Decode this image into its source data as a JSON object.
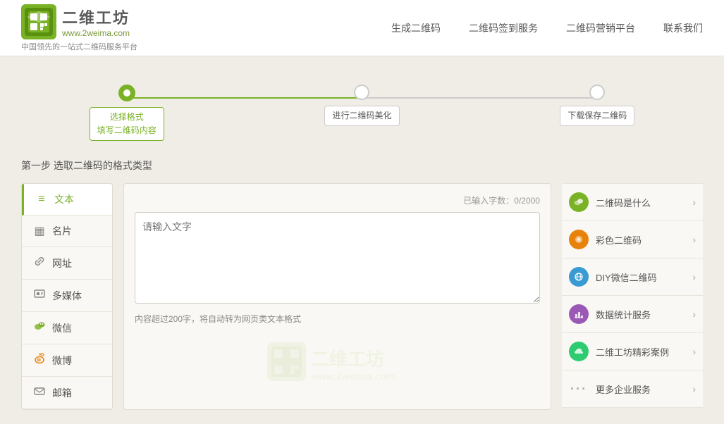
{
  "header": {
    "logo_title": "二维工坊",
    "logo_url": "www.2weima.com",
    "logo_subtitle": "中国领先的一站式二维码服务平台",
    "nav": [
      {
        "label": "生成二维码",
        "id": "nav-generate"
      },
      {
        "label": "二维码签到服务",
        "id": "nav-checkin"
      },
      {
        "label": "二维码营销平台",
        "id": "nav-marketing"
      },
      {
        "label": "联系我们",
        "id": "nav-contact"
      }
    ]
  },
  "steps": [
    {
      "label": "选择格式\n填写二维码内容",
      "active": true
    },
    {
      "label": "进行二维码美化",
      "active": false
    },
    {
      "label": "下载保存二维码",
      "active": false
    }
  ],
  "section_title": "第一步 选取二维码的格式类型",
  "sidebar": {
    "items": [
      {
        "id": "text",
        "label": "文本",
        "icon": "≡",
        "active": true
      },
      {
        "id": "card",
        "label": "名片",
        "icon": "▦"
      },
      {
        "id": "url",
        "label": "网址",
        "icon": "🔗"
      },
      {
        "id": "media",
        "label": "多媒体",
        "icon": "📋"
      },
      {
        "id": "wechat",
        "label": "微信",
        "icon": "💬"
      },
      {
        "id": "weibo",
        "label": "微博",
        "icon": "🐦"
      },
      {
        "id": "email",
        "label": "邮箱",
        "icon": "✉"
      }
    ]
  },
  "textarea": {
    "char_count_label": "已输入字数：0/2000",
    "placeholder": "请输入文字",
    "hint": "内容超过200字，将自动转为网页类文本格式"
  },
  "watermark": {
    "logo": "二维工坊",
    "url": "www.2weima.com"
  },
  "right_panel": {
    "items": [
      {
        "id": "what",
        "label": "二维码是什么",
        "icon_type": "green",
        "icon": "💬"
      },
      {
        "id": "color",
        "label": "彩色二维码",
        "icon_type": "orange",
        "icon": "🌐"
      },
      {
        "id": "diy",
        "label": "DIY微信二维码",
        "icon_type": "blue",
        "icon": "🌍"
      },
      {
        "id": "stats",
        "label": "数据统计服务",
        "icon_type": "purple",
        "icon": "📊"
      },
      {
        "id": "cases",
        "label": "二维工坊精彩案例",
        "icon_type": "cyan",
        "icon": "☁"
      },
      {
        "id": "more",
        "label": "更多企业服务",
        "icon_type": "dots",
        "icon": "···"
      }
    ]
  }
}
